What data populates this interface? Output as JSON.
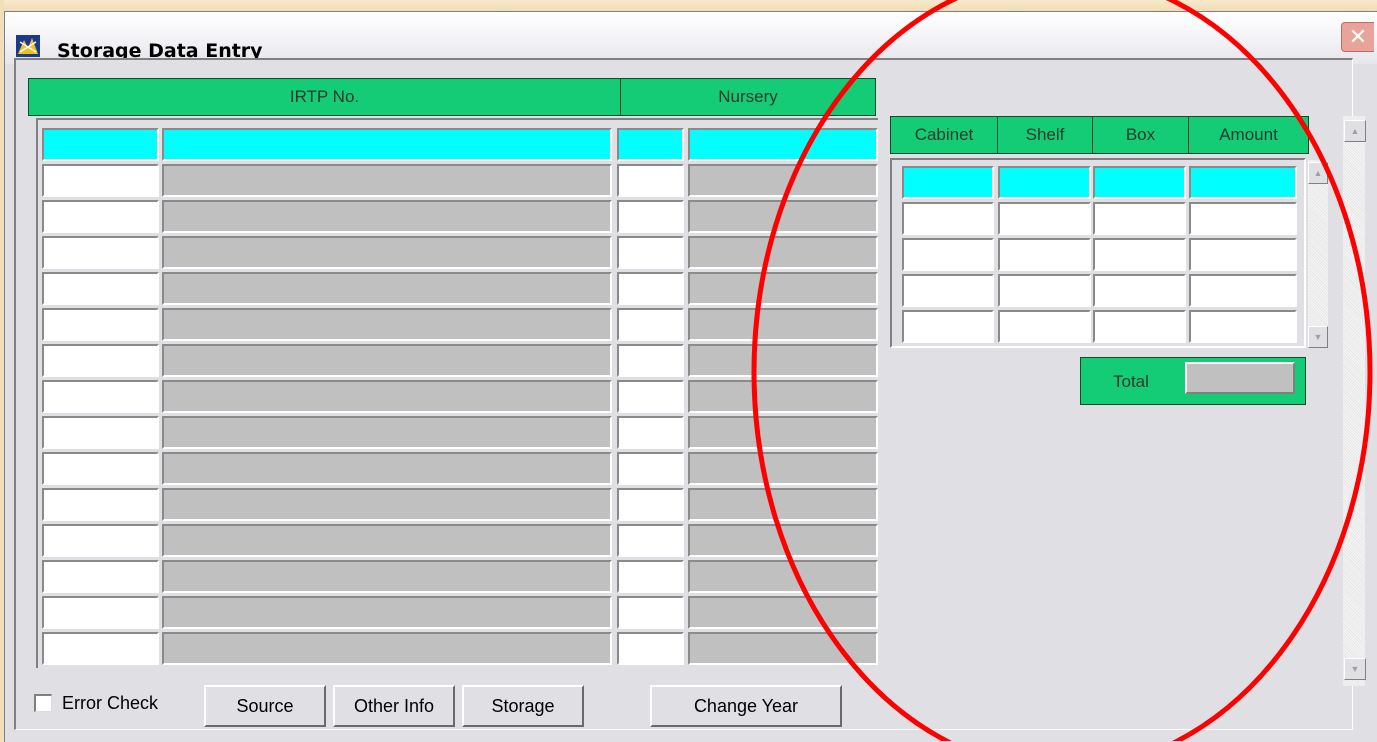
{
  "window": {
    "title": "Storage Data Entry",
    "close_glyph": "✕"
  },
  "left_table": {
    "headers": {
      "irtp_no": "IRTP No.",
      "nursery": "Nursery"
    },
    "row_count": 15,
    "selected_row": 0
  },
  "right_table": {
    "headers": [
      "Cabinet",
      "Shelf",
      "Box",
      "Amount"
    ],
    "row_count": 5,
    "selected_row": 0
  },
  "total": {
    "label": "Total",
    "value": ""
  },
  "buttons": {
    "error_check_label": "Error Check",
    "error_check_checked": false,
    "source": "Source",
    "other_info": "Other Info",
    "storage": "Storage",
    "change_year": "Change Year"
  },
  "scroll": {
    "up": "▲",
    "down": "▼"
  },
  "colors": {
    "header_green": "#14cc76",
    "selected_cyan": "#00ffff",
    "readonly_gray": "#c0c0c0",
    "annotation_red": "#ff0000"
  }
}
